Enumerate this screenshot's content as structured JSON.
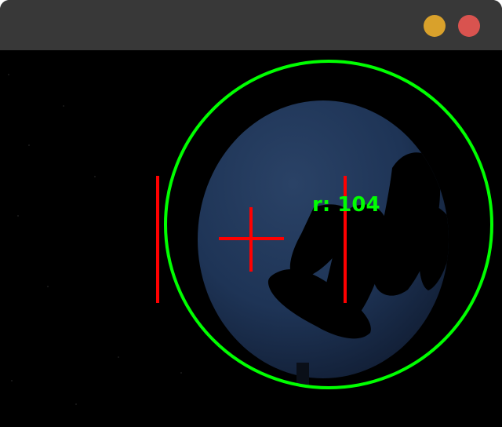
{
  "window": {
    "minimize_color": "#d9a12b",
    "close_color": "#d9534f"
  },
  "overlay": {
    "circle_color": "#00ff00",
    "marker_color": "#ff0000",
    "radius_label": "r: 104",
    "radius_value": 104
  },
  "scene": {
    "object_color": "#1e3456"
  }
}
